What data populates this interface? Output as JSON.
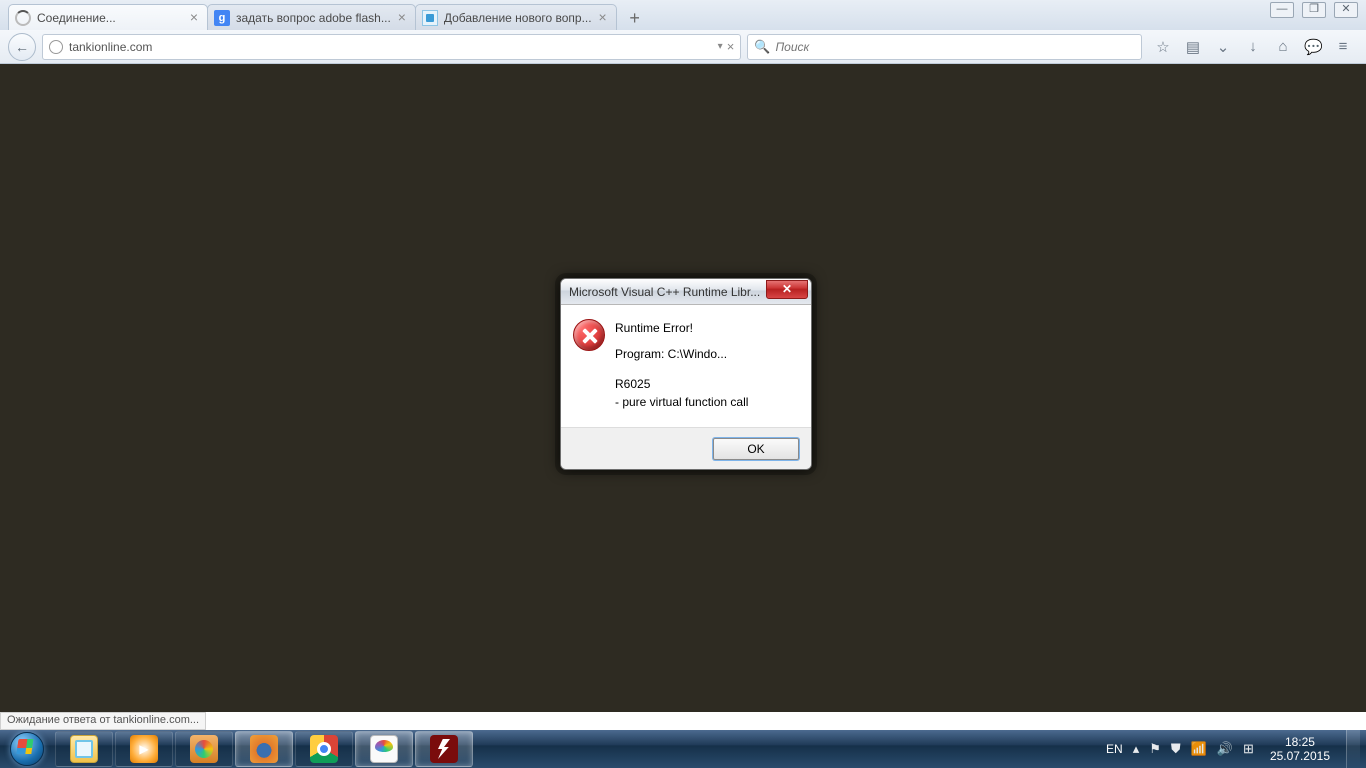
{
  "browser": {
    "tabs": [
      {
        "title": "Соединение...",
        "active": true
      },
      {
        "title": "задать вопрос adobe flash...",
        "active": false
      },
      {
        "title": "Добавление нового вопр...",
        "active": false
      }
    ],
    "url": "tankionline.com",
    "search_placeholder": "Поиск",
    "status": "Ожидание ответа от tankionline.com..."
  },
  "dialog": {
    "title": "Microsoft Visual C++ Runtime Libr...",
    "heading": "Runtime Error!",
    "program": "Program: C:\\Windo...",
    "code": "R6025",
    "detail": "- pure virtual function call",
    "ok": "OK"
  },
  "tray": {
    "lang": "EN",
    "time": "18:25",
    "date": "25.07.2015"
  },
  "winctrl": {
    "min": "—",
    "max": "❐",
    "close": "✕"
  }
}
